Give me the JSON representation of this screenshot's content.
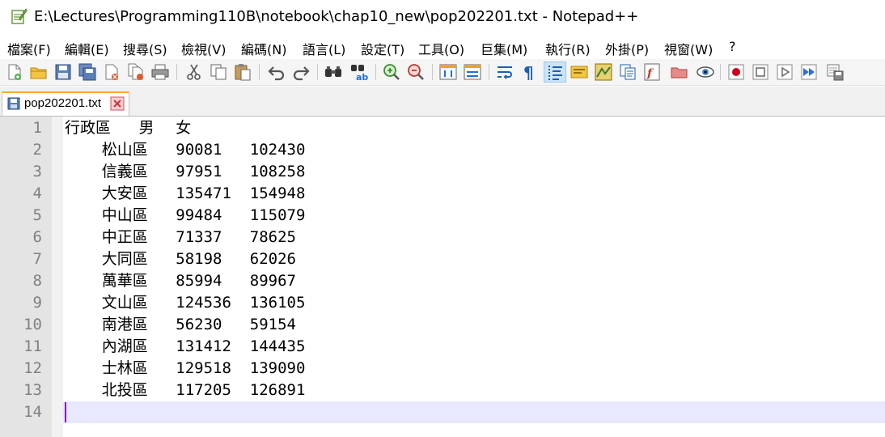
{
  "window": {
    "title": "E:\\Lectures\\Programming110B\\notebook\\chap10_new\\pop202201.txt - Notepad++"
  },
  "menu": {
    "items": [
      "檔案(F)",
      "編輯(E)",
      "搜尋(S)",
      "檢視(V)",
      "編碼(N)",
      "語言(L)",
      "設定(T)",
      "工具(O)",
      "巨集(M)",
      "執行(R)",
      "外掛(P)",
      "視窗(W)",
      "?"
    ]
  },
  "toolbar": {
    "buttons": [
      "new-file-icon",
      "open-file-icon",
      "save-icon",
      "save-all-icon",
      "close-icon",
      "close-all-icon",
      "print-icon",
      "cut-icon",
      "copy-icon",
      "paste-icon",
      "undo-icon",
      "redo-icon",
      "find-icon",
      "replace-icon",
      "zoom-in-icon",
      "zoom-out-icon",
      "sync-vertical-icon",
      "sync-horizontal-icon",
      "word-wrap-icon",
      "show-all-chars-icon",
      "indent-guide-icon",
      "user-language-icon",
      "doc-map-icon",
      "doc-list-icon",
      "function-list-icon",
      "folder-workspace-icon",
      "monitoring-icon",
      "record-macro-icon",
      "stop-record-icon",
      "playback-macro-icon",
      "run-multiple-macro-icon",
      "save-macro-icon"
    ]
  },
  "tab": {
    "label": "pop202201.txt"
  },
  "editor": {
    "line_numbers": [
      "1",
      "2",
      "3",
      "4",
      "5",
      "6",
      "7",
      "8",
      "9",
      "10",
      "11",
      "12",
      "13",
      "14"
    ],
    "lines": [
      "行政區\t男\t女",
      "\t松山區\t90081\t102430",
      "\t信義區\t97951\t108258",
      "\t大安區\t135471\t154948",
      "\t中山區\t99484\t115079",
      "\t中正區\t71337\t78625",
      "\t大同區\t58198\t62026",
      "\t萬華區\t85994\t89967",
      "\t文山區\t124536\t136105",
      "\t南港區\t56230\t59154",
      "\t內湖區\t131412\t144435",
      "\t士林區\t129518\t139090",
      "\t北投區\t117205\t126891",
      ""
    ],
    "current_line": 14
  }
}
